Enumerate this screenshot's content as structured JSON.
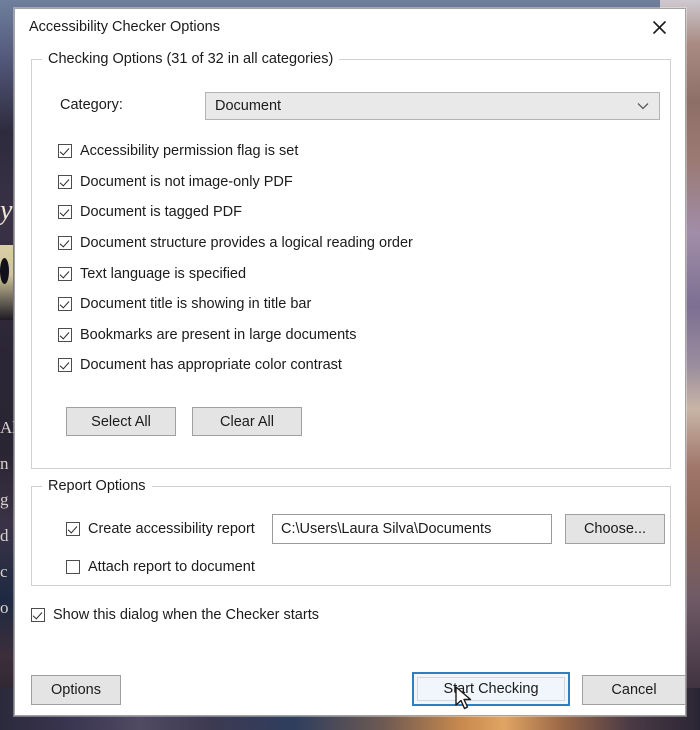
{
  "window": {
    "title": "Accessibility Checker Options",
    "close_icon": "close-icon"
  },
  "checking_options": {
    "legend": "Checking Options (31 of 32 in all categories)",
    "category_label": "Category:",
    "category_value": "Document",
    "category_chevron_icon": "chevron-down-icon",
    "items": [
      {
        "label": "Accessibility permission flag is set",
        "checked": true
      },
      {
        "label": "Document is not image-only PDF",
        "checked": true
      },
      {
        "label": "Document is tagged PDF",
        "checked": true
      },
      {
        "label": "Document structure provides a logical reading order",
        "checked": true
      },
      {
        "label": "Text language is specified",
        "checked": true
      },
      {
        "label": "Document title is showing in title bar",
        "checked": true
      },
      {
        "label": "Bookmarks are present in large documents",
        "checked": true
      },
      {
        "label": "Document has appropriate color contrast",
        "checked": true
      }
    ],
    "select_all_label": "Select All",
    "clear_all_label": "Clear All"
  },
  "report_options": {
    "legend": "Report Options",
    "create_report_label": "Create accessibility report",
    "create_report_checked": true,
    "path_value": "C:\\Users\\Laura Silva\\Documents",
    "choose_label": "Choose...",
    "attach_report_label": "Attach report to document",
    "attach_report_checked": false
  },
  "show_dialog": {
    "label": "Show this dialog when the Checker starts",
    "checked": true
  },
  "footer": {
    "options_label": "Options",
    "start_checking_label": "Start Checking",
    "cancel_label": "Cancel"
  },
  "background": {
    "left_text_lines": [
      "Al",
      "n",
      "g",
      "d",
      "c",
      "o"
    ],
    "script_glyph": "y"
  },
  "colors": {
    "accent": "#2b7fc4",
    "dialog_bg": "#ffffff",
    "button_bg": "#e4e4e4",
    "group_border": "#d0d0d0",
    "text": "#1b1b1b"
  }
}
